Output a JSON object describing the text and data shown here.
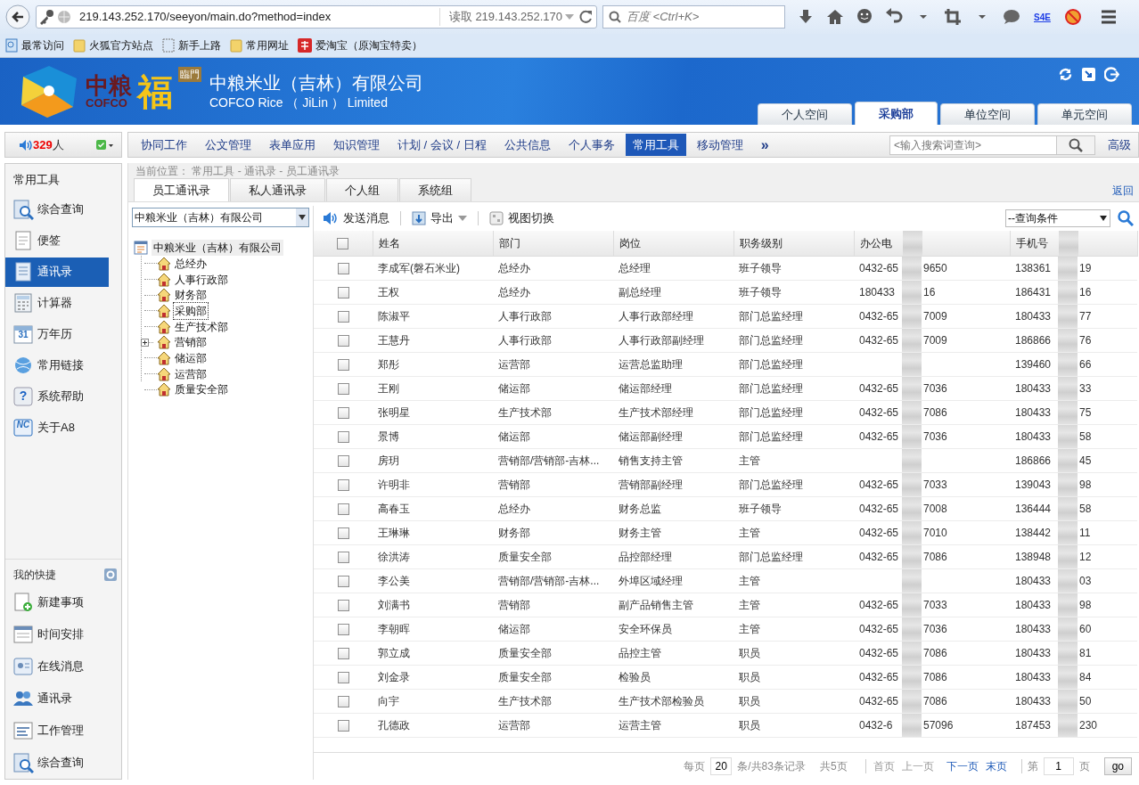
{
  "browser": {
    "url": "219.143.252.170/seeyon/main.do?method=index",
    "reader": "读取 219.143.252.170",
    "search_placeholder": "百度 <Ctrl+K>",
    "addon_label": "S4E",
    "bookmarks": [
      {
        "label": "最常访问",
        "kind": "smart"
      },
      {
        "label": "火狐官方站点",
        "kind": "folder"
      },
      {
        "label": "新手上路",
        "kind": "page"
      },
      {
        "label": "常用网址",
        "kind": "folder"
      },
      {
        "label": "爱淘宝（原淘宝特卖）",
        "kind": "taobao"
      }
    ]
  },
  "header": {
    "logo": {
      "cn": "中粮",
      "en": "COFCO",
      "fu": "福",
      "lin": "臨門"
    },
    "title": "中粮米业（吉林）有限公司",
    "subtitle": "COFCO Rice （ JiLin ） Limited",
    "space_tabs": [
      {
        "label": "个人空间",
        "selected": false
      },
      {
        "label": "采购部",
        "selected": true
      },
      {
        "label": "单位空间",
        "selected": false
      },
      {
        "label": "单元空间",
        "selected": false
      }
    ]
  },
  "online": {
    "count": "329",
    "unit": "人"
  },
  "nav": {
    "items": [
      {
        "label": "协同工作",
        "selected": false
      },
      {
        "label": "公文管理",
        "selected": false
      },
      {
        "label": "表单应用",
        "selected": false
      },
      {
        "label": "知识管理",
        "selected": false
      },
      {
        "label": "计划 / 会议 / 日程",
        "selected": false
      },
      {
        "label": "公共信息",
        "selected": false
      },
      {
        "label": "个人事务",
        "selected": false
      },
      {
        "label": "常用工具",
        "selected": true
      },
      {
        "label": "移动管理",
        "selected": false
      }
    ],
    "more": "»",
    "search_placeholder": "<输入搜索词查询>",
    "advanced": "高级"
  },
  "sidebar": {
    "title": "常用工具",
    "items": [
      {
        "label": "综合查询",
        "selected": false
      },
      {
        "label": "便签",
        "selected": false
      },
      {
        "label": "通讯录",
        "selected": true
      },
      {
        "label": "计算器",
        "selected": false
      },
      {
        "label": "万年历",
        "icon_text": "31",
        "selected": false
      },
      {
        "label": "常用链接",
        "selected": false
      },
      {
        "label": "系统帮助",
        "icon_text": "?",
        "selected": false
      },
      {
        "label": "关于A8",
        "icon_text": "NC",
        "selected": false
      }
    ],
    "shortcuts_title": "我的快捷",
    "shortcuts": [
      {
        "label": "新建事项"
      },
      {
        "label": "时间安排"
      },
      {
        "label": "在线消息"
      },
      {
        "label": "通讯录"
      },
      {
        "label": "工作管理"
      },
      {
        "label": "综合查询"
      }
    ]
  },
  "breadcrumb": "当前位置： 常用工具 - 通讯录 - 员工通讯录",
  "tabs": [
    {
      "label": "员工通讯录",
      "selected": true
    },
    {
      "label": "私人通讯录",
      "selected": false
    },
    {
      "label": "个人组",
      "selected": false
    },
    {
      "label": "系统组",
      "selected": false
    }
  ],
  "back": "返回",
  "tree": {
    "dropdown": "中粮米业（吉林）有限公司",
    "root": "中粮米业（吉林）有限公司",
    "children": [
      {
        "label": "总经办",
        "selected": false,
        "kind": "leaf"
      },
      {
        "label": "人事行政部",
        "selected": false,
        "kind": "leaf"
      },
      {
        "label": "财务部",
        "selected": false,
        "kind": "leaf"
      },
      {
        "label": "采购部",
        "selected": true,
        "kind": "leaf"
      },
      {
        "label": "生产技术部",
        "selected": false,
        "kind": "leaf"
      },
      {
        "label": "营销部",
        "selected": false,
        "kind": "collapsed"
      },
      {
        "label": "储运部",
        "selected": false,
        "kind": "leaf"
      },
      {
        "label": "运营部",
        "selected": false,
        "kind": "leaf"
      },
      {
        "label": "质量安全部",
        "selected": false,
        "kind": "leaf"
      }
    ]
  },
  "toolbar": {
    "buttons": [
      {
        "label": "发送消息"
      },
      {
        "label": "导出"
      },
      {
        "label": "视图切换"
      }
    ],
    "query_select": "--查询条件"
  },
  "table": {
    "select_all": false,
    "columns": [
      "姓名",
      "部门",
      "岗位",
      "职务级别",
      "办公电",
      "手机号"
    ],
    "rows": [
      {
        "checked": false,
        "name": "李成军(磐石米业)",
        "dept": "总经办",
        "post": "总经理",
        "rank": "班子领导",
        "office": [
          "0432-65",
          "9650"
        ],
        "mobile": [
          "138361",
          "19"
        ]
      },
      {
        "checked": false,
        "name": "王权",
        "dept": "总经办",
        "post": "副总经理",
        "rank": "班子领导",
        "office": [
          "180433",
          "16"
        ],
        "mobile": [
          "186431",
          "16"
        ]
      },
      {
        "checked": false,
        "name": "陈淑平",
        "dept": "人事行政部",
        "post": "人事行政部经理",
        "rank": "部门总监经理",
        "office": [
          "0432-65",
          "7009"
        ],
        "mobile": [
          "180433",
          "77"
        ]
      },
      {
        "checked": false,
        "name": "王慧丹",
        "dept": "人事行政部",
        "post": "人事行政部副经理",
        "rank": "部门总监经理",
        "office": [
          "0432-65",
          "7009"
        ],
        "mobile": [
          "186866",
          "76"
        ]
      },
      {
        "checked": false,
        "name": "郑彤",
        "dept": "运营部",
        "post": "运营总监助理",
        "rank": "部门总监经理",
        "mobile": [
          "139460",
          "66"
        ]
      },
      {
        "checked": false,
        "name": "王刚",
        "dept": "储运部",
        "post": "储运部经理",
        "rank": "部门总监经理",
        "office": [
          "0432-65",
          "7036"
        ],
        "mobile": [
          "180433",
          "33"
        ]
      },
      {
        "checked": false,
        "name": "张明星",
        "dept": "生产技术部",
        "post": "生产技术部经理",
        "rank": "部门总监经理",
        "office": [
          "0432-65",
          "7086"
        ],
        "mobile": [
          "180433",
          "75"
        ]
      },
      {
        "checked": false,
        "name": "景博",
        "dept": "储运部",
        "post": "储运部副经理",
        "rank": "部门总监经理",
        "office": [
          "0432-65",
          "7036"
        ],
        "mobile": [
          "180433",
          "58"
        ]
      },
      {
        "checked": false,
        "name": "房玥",
        "dept": "营销部/营销部-吉林...",
        "post": "销售支持主管",
        "rank": "主管",
        "mobile": [
          "186866",
          "45"
        ]
      },
      {
        "checked": false,
        "name": "许明非",
        "dept": "营销部",
        "post": "营销部副经理",
        "rank": "部门总监经理",
        "office": [
          "0432-65",
          "7033"
        ],
        "mobile": [
          "139043",
          "98"
        ]
      },
      {
        "checked": false,
        "name": "高春玉",
        "dept": "总经办",
        "post": "财务总监",
        "rank": "班子领导",
        "office": [
          "0432-65",
          "7008"
        ],
        "mobile": [
          "136444",
          "58"
        ]
      },
      {
        "checked": false,
        "name": "王琳琳",
        "dept": "财务部",
        "post": "财务主管",
        "rank": "主管",
        "office": [
          "0432-65",
          "7010"
        ],
        "mobile": [
          "138442",
          "11"
        ]
      },
      {
        "checked": false,
        "name": "徐洪涛",
        "dept": "质量安全部",
        "post": "品控部经理",
        "rank": "部门总监经理",
        "office": [
          "0432-65",
          "7086"
        ],
        "mobile": [
          "138948",
          "12"
        ]
      },
      {
        "checked": false,
        "name": "李公美",
        "dept": "营销部/营销部-吉林...",
        "post": "外埠区域经理",
        "rank": "主管",
        "mobile": [
          "180433",
          "03"
        ]
      },
      {
        "checked": false,
        "name": "刘满书",
        "dept": "营销部",
        "post": "副产品销售主管",
        "rank": "主管",
        "office": [
          "0432-65",
          "7033"
        ],
        "mobile": [
          "180433",
          "98"
        ]
      },
      {
        "checked": false,
        "name": "李朝晖",
        "dept": "储运部",
        "post": "安全环保员",
        "rank": "主管",
        "office": [
          "0432-65",
          "7036"
        ],
        "mobile": [
          "180433",
          "60"
        ]
      },
      {
        "checked": false,
        "name": "郭立成",
        "dept": "质量安全部",
        "post": "品控主管",
        "rank": "职员",
        "office": [
          "0432-65",
          "7086"
        ],
        "mobile": [
          "180433",
          "81"
        ]
      },
      {
        "checked": false,
        "name": "刘金录",
        "dept": "质量安全部",
        "post": "检验员",
        "rank": "职员",
        "office": [
          "0432-65",
          "7086"
        ],
        "mobile": [
          "180433",
          "84"
        ]
      },
      {
        "checked": false,
        "name": "向宇",
        "dept": "生产技术部",
        "post": "生产技术部检验员",
        "rank": "职员",
        "office": [
          "0432-65",
          "7086"
        ],
        "mobile": [
          "180433",
          "50"
        ]
      },
      {
        "checked": false,
        "name": "孔德政",
        "dept": "运营部",
        "post": "运营主管",
        "rank": "职员",
        "office": [
          "0432-6",
          "57096"
        ],
        "mobile": [
          "187453",
          "230"
        ]
      }
    ]
  },
  "pagination": {
    "per_page_label": "每页",
    "per_page": "20",
    "records": "条/共83条记录",
    "pages": "共5页",
    "links": [
      {
        "label": "首页",
        "disabled": true
      },
      {
        "label": "上一页",
        "disabled": true
      },
      {
        "label": "下一页",
        "disabled": false
      },
      {
        "label": "末页",
        "disabled": false
      }
    ],
    "page_prefix": "第",
    "page": "1",
    "page_suffix": "页",
    "go": "go"
  }
}
